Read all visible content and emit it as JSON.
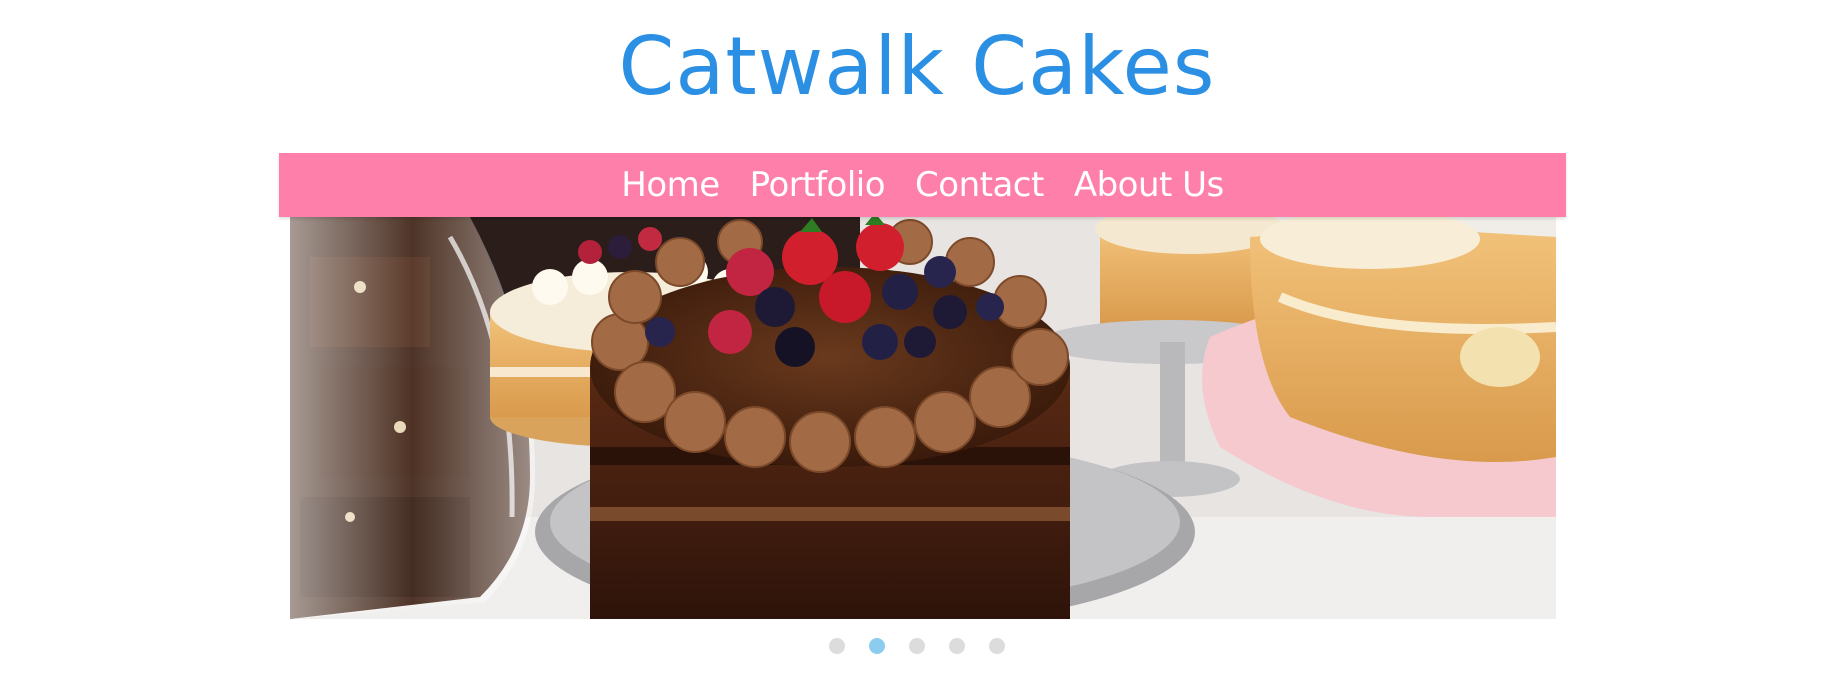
{
  "site": {
    "title": "Catwalk Cakes"
  },
  "nav": {
    "items": [
      {
        "label": "Home"
      },
      {
        "label": "Portfolio"
      },
      {
        "label": "Contact"
      },
      {
        "label": "About Us"
      }
    ]
  },
  "slideshow": {
    "slide_count": 5,
    "active_index": 1,
    "current_image": "chocolate-layer-cake-with-berries-photo"
  },
  "colors": {
    "title": "#2b90e4",
    "nav_background": "#ff7fab",
    "nav_text": "#ffffff",
    "dot_active": "#8ccdef",
    "dot_inactive": "#dcdcdc"
  }
}
